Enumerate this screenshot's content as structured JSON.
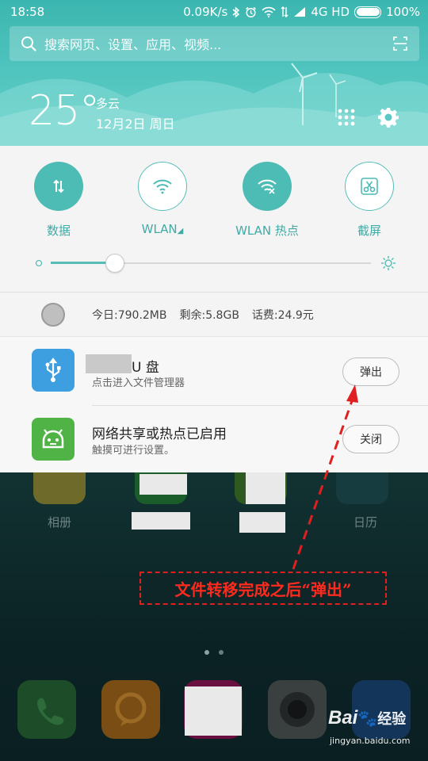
{
  "status_bar": {
    "time": "18:58",
    "speed": "0.09K/s",
    "network": "4G HD",
    "battery": "100%"
  },
  "search": {
    "placeholder": "搜索网页、设置、应用、视频..."
  },
  "weather": {
    "temperature": "25°",
    "condition": "多云",
    "date": "12月2日 周日"
  },
  "quick_toggles": [
    {
      "label": "数据",
      "state": "on",
      "icon": "data-arrows-icon"
    },
    {
      "label": "WLAN",
      "state": "off",
      "icon": "wifi-icon"
    },
    {
      "label": "WLAN 热点",
      "state": "on",
      "icon": "hotspot-icon"
    },
    {
      "label": "截屏",
      "state": "off",
      "icon": "scissors-icon"
    }
  ],
  "brightness": {
    "level": 0.2
  },
  "usage": {
    "today": "今日:790.2MB",
    "remaining": "剩余:5.8GB",
    "balance": "话费:24.9元"
  },
  "notifications": [
    {
      "title": "U 盘",
      "subtitle": "点击进入文件管理器",
      "button": "弹出",
      "icon": "usb-icon",
      "icon_color": "#3d9ee0"
    },
    {
      "title": "网络共享或热点已启用",
      "subtitle": "触摸可进行设置。",
      "button": "关闭",
      "icon": "android-icon",
      "icon_color": "#4fb346"
    }
  ],
  "home": {
    "labels": [
      "相册",
      "日历"
    ]
  },
  "annotation": {
    "text": "文件转移完成之后“弹出”",
    "color": "#ff2a1e"
  },
  "watermark": {
    "brand": "Bai",
    "suffix": "经验",
    "url": "jingyan.baidu.com"
  }
}
